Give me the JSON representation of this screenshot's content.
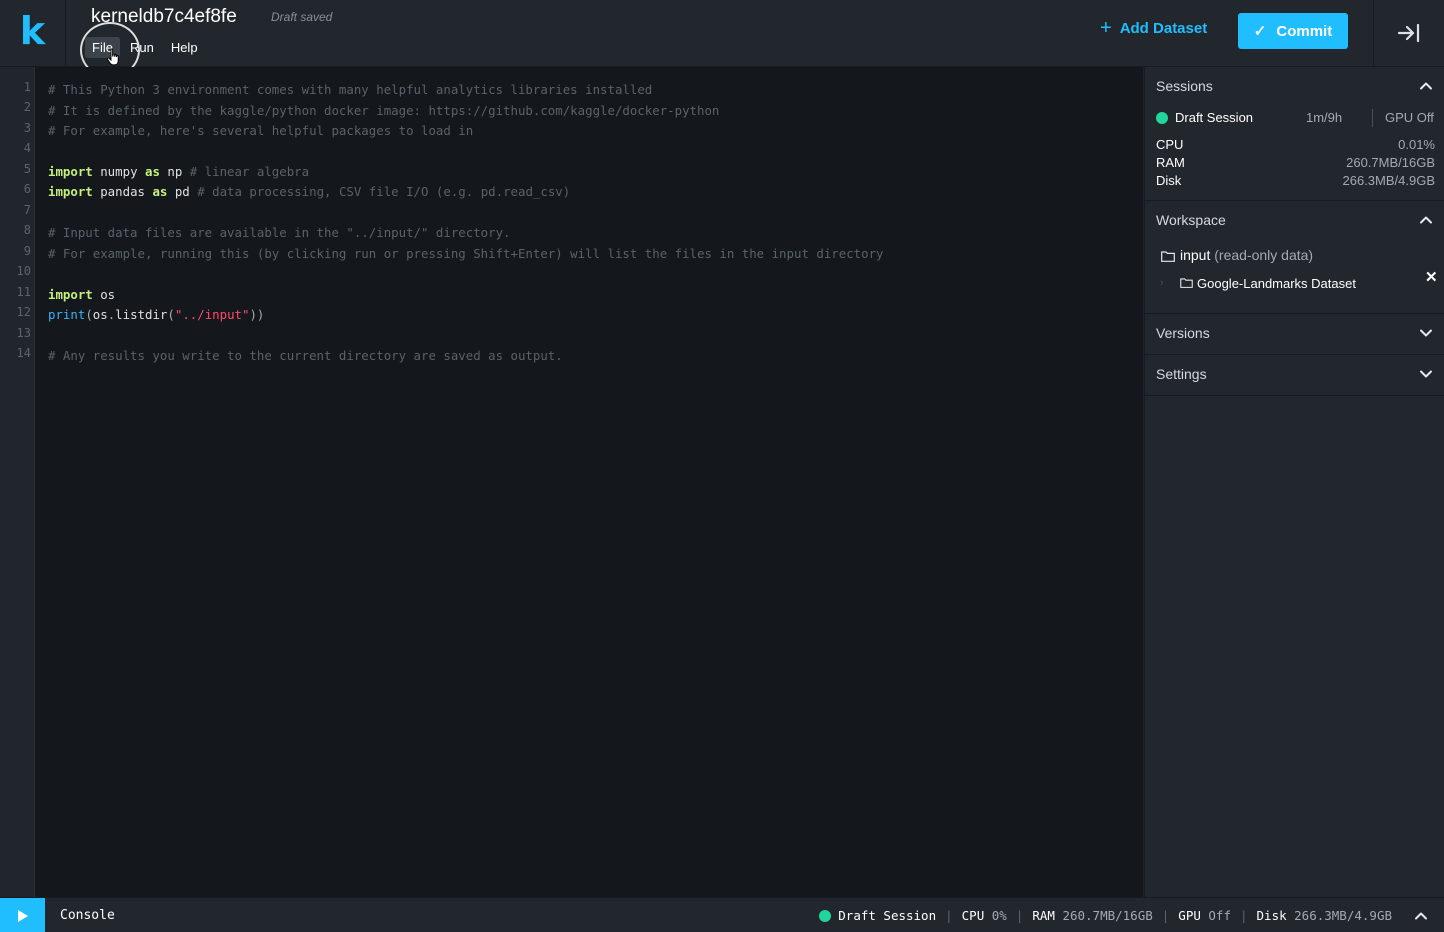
{
  "header": {
    "logo": "k",
    "title": "kerneldb7c4ef8fe",
    "draft_status": "Draft saved",
    "menu": [
      "File",
      "Run",
      "Help"
    ],
    "add_dataset_label": "Add Dataset",
    "commit_label": "Commit"
  },
  "editor": {
    "line_numbers": [
      "1",
      "2",
      "3",
      "4",
      "5",
      "6",
      "7",
      "8",
      "9",
      "10",
      "11",
      "12",
      "13",
      "14"
    ],
    "lines": [
      {
        "comment": "# This Python 3 environment comes with many helpful analytics libraries installed"
      },
      {
        "comment": "# It is defined by the kaggle/python docker image: https://github.com/kaggle/docker-python"
      },
      {
        "comment": "# For example, here's several helpful packages to load in"
      },
      {},
      {
        "kw1": "import",
        "mod": " numpy ",
        "kw2": "as",
        "alias": " np ",
        "comment": "# linear algebra"
      },
      {
        "kw1": "import",
        "mod": " pandas ",
        "kw2": "as",
        "alias": " pd ",
        "comment": "# data processing, CSV file I/O (e.g. pd.read_csv)"
      },
      {},
      {
        "comment": "# Input data files are available in the \"../input/\" directory."
      },
      {
        "comment": "# For example, running this (by clicking run or pressing Shift+Enter) will list the files in the input directory"
      },
      {},
      {
        "kw1": "import",
        "mod": " os"
      },
      {
        "fn": "print",
        "p1": "(",
        "obj": "os",
        "dot": ".",
        "call": "listdir",
        "p2": "(",
        "str": "\"../input\"",
        "p3": "))"
      },
      {},
      {
        "comment": "# Any results you write to the current directory are saved as output."
      }
    ]
  },
  "sidebar": {
    "sessions": {
      "title": "Sessions",
      "session_name": "Draft Session",
      "session_time": "1m/9h",
      "gpu_status": "GPU Off",
      "stats": [
        {
          "label": "CPU",
          "value": "0.01%"
        },
        {
          "label": "RAM",
          "value": "260.7MB/16GB"
        },
        {
          "label": "Disk",
          "value": "266.3MB/4.9GB"
        }
      ]
    },
    "workspace": {
      "title": "Workspace",
      "folder_name": "input",
      "folder_note": "(read-only data)",
      "dataset_name": "Google-Landmarks Dataset"
    },
    "versions_title": "Versions",
    "settings_title": "Settings"
  },
  "statusbar": {
    "console_label": "Console",
    "session_name": "Draft Session",
    "cpu_label": "CPU",
    "cpu_value": "0%",
    "ram_label": "RAM",
    "ram_value": "260.7MB/16GB",
    "gpu_label": "GPU",
    "gpu_value": "Off",
    "disk_label": "Disk",
    "disk_value": "266.3MB/4.9GB"
  },
  "colors": {
    "accent": "#20beff",
    "session_active": "#20d69b",
    "string": "#ff4a6a",
    "keyword": "#c5f07c"
  }
}
